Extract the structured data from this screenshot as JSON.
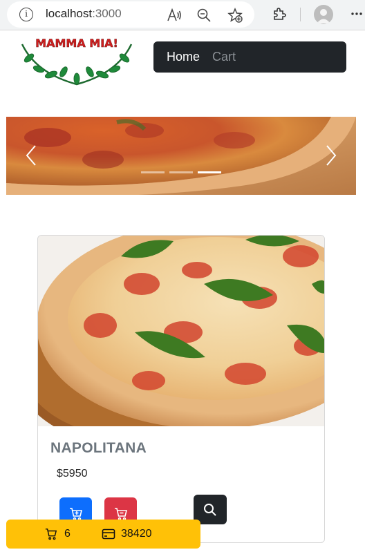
{
  "browser": {
    "url_host": "localhost",
    "url_port": ":3000"
  },
  "logo": {
    "text": "MAMMA MIA!"
  },
  "navbar": {
    "home_label": "Home",
    "cart_label": "Cart"
  },
  "carousel": {
    "slide_count": 3,
    "active_index": 2
  },
  "product": {
    "name": "NAPOLITANA",
    "price": "$5950"
  },
  "totals": {
    "count": "6",
    "total": "38420"
  },
  "colors": {
    "navbar": "#212529",
    "add_button": "#0d6efd",
    "remove_button": "#dc3545",
    "detail_button": "#212529",
    "totals_bar": "#ffc107"
  },
  "icons": {
    "address_info": "info-icon",
    "read_aloud": "read-aloud-icon",
    "zoom_out": "zoom-out-icon",
    "favorites": "add-favorite-icon",
    "extensions": "puzzle-icon",
    "more": "more-icon",
    "carousel_prev": "chevron-left-icon",
    "carousel_next": "chevron-right-icon",
    "add": "cart-plus-icon",
    "remove": "cart-remove-icon",
    "detail": "search-icon",
    "cart": "cart-icon",
    "wallet": "wallet-icon"
  }
}
